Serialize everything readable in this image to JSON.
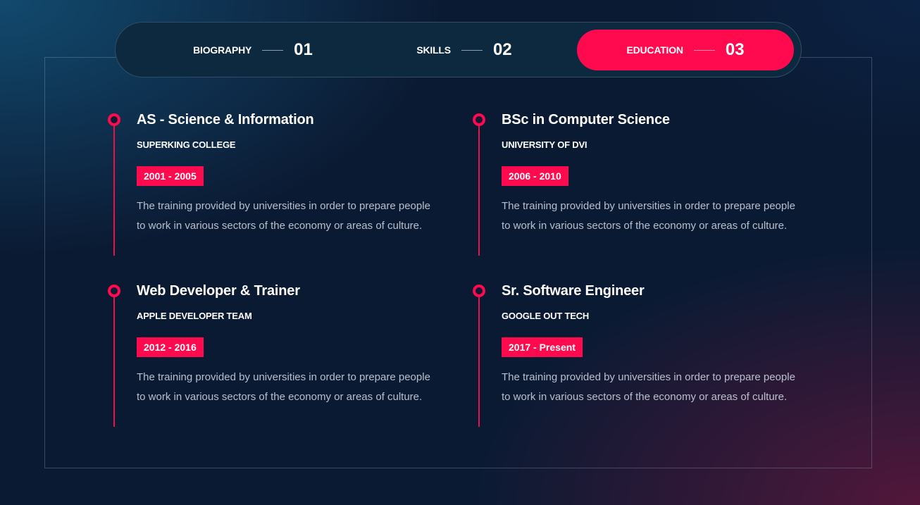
{
  "tabs": [
    {
      "label": "BIOGRAPHY",
      "number": "01"
    },
    {
      "label": "SKILLS",
      "number": "02"
    },
    {
      "label": "EDUCATION",
      "number": "03"
    }
  ],
  "active_tab": "EDUCATION",
  "education": [
    {
      "title": "AS - Science & Information",
      "organization": "SUPERKING COLLEGE",
      "years": "2001 - 2005",
      "description": "The training provided by universities in order to prepare people to work in various sectors of the economy or areas of culture."
    },
    {
      "title": "BSc in Computer Science",
      "organization": "UNIVERSITY OF DVI",
      "years": "2006 - 2010",
      "description": "The training provided by universities in order to prepare people to work in various sectors of the economy or areas of culture."
    },
    {
      "title": "Web Developer & Trainer",
      "organization": "APPLE DEVELOPER TEAM",
      "years": "2012 - 2016",
      "description": "The training provided by universities in order to prepare people to work in various sectors of the economy or areas of culture."
    },
    {
      "title": "Sr. Software Engineer",
      "organization": "GOOGLE OUT TECH",
      "years": "2017 - Present",
      "description": "The training provided by universities in order to prepare people to work in various sectors of the economy or areas of culture."
    }
  ],
  "colors": {
    "accent": "#ff0a4e",
    "background": "#0b1a33",
    "tab_bar": "#0c2940"
  }
}
